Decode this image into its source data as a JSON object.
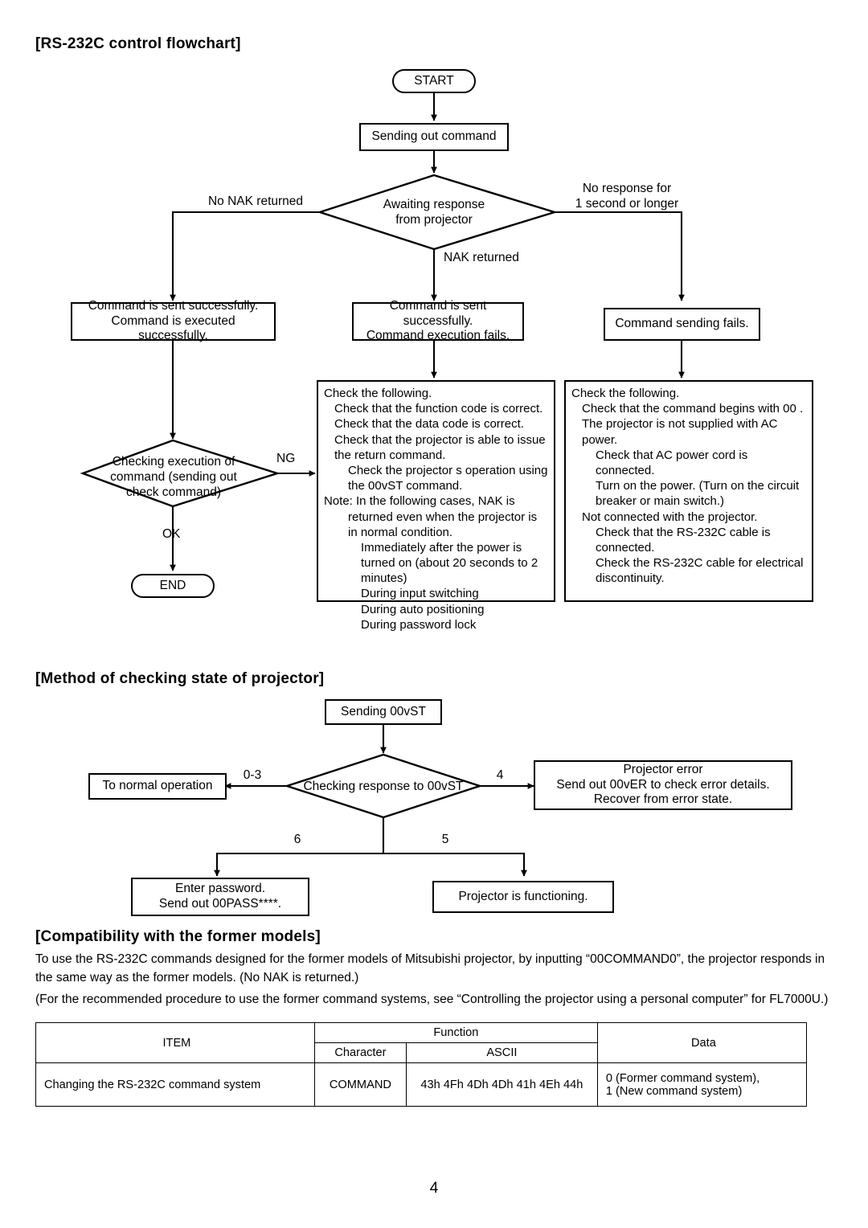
{
  "page": {
    "number": "4"
  },
  "sections": {
    "flowchart": {
      "heading": "[RS-232C control  flowchart]",
      "nodes": {
        "start": "START",
        "sending_out_command": "Sending out command",
        "awaiting_response": "Awaiting response\nfrom projector",
        "ok_box": "Command is sent successfully.\nCommand is executed successfully.",
        "nak_box": "Command is sent successfully.\nCommand execution fails.",
        "fail_box": "Command sending fails.",
        "checking_execution": "Checking execution of\ncommand (sending out\ncheck command)",
        "end": "END"
      },
      "edge_labels": {
        "no_nak": "No NAK returned",
        "nak": "NAK returned",
        "no_response": "No response for\n1 second or longer",
        "ng": "NG",
        "ok": "OK"
      },
      "detail_nak": {
        "title": "Check the following.",
        "lines": [
          {
            "indent": 1,
            "text": "Check that the function code is correct."
          },
          {
            "indent": 1,
            "text": "Check that the data code is correct."
          },
          {
            "indent": 1,
            "text": "Check that the projector is able to issue the return command."
          },
          {
            "indent": 2,
            "text": "Check the projector s operation using the 00vST command."
          },
          {
            "indent": 0,
            "text": "Note:  In the following cases, NAK is"
          },
          {
            "indent": 2,
            "text": "returned even when the projector is in normal condition."
          },
          {
            "indent": 3,
            "text": "Immediately after the power is turned on (about 20 seconds to 2 minutes)"
          },
          {
            "indent": 3,
            "text": "During input switching"
          },
          {
            "indent": 3,
            "text": "During auto positioning"
          },
          {
            "indent": 3,
            "text": "During password lock"
          }
        ]
      },
      "detail_fail": {
        "title": "Check the following.",
        "lines": [
          {
            "indent": 1,
            "text": "Check that the command begins with  00 ."
          },
          {
            "indent": 1,
            "text": "The projector is not supplied with AC power."
          },
          {
            "indent": 2,
            "text": "Check that AC power cord is connected."
          },
          {
            "indent": 2,
            "text": "Turn on the power. (Turn on the circuit breaker or main switch.)"
          },
          {
            "indent": 1,
            "text": "Not connected with the projector."
          },
          {
            "indent": 2,
            "text": "Check that the RS-232C cable is connected."
          },
          {
            "indent": 2,
            "text": "Check the RS-232C cable for electrical discontinuity."
          }
        ]
      }
    },
    "method": {
      "heading": "[Method of checking state of projector]",
      "nodes": {
        "sending": "Sending 00vST",
        "checking": "Checking response to 00vST",
        "normal": "To normal operation",
        "error": "Projector error\nSend out  00vER  to check error details.\nRecover from error state.",
        "password": "Enter password.\nSend out  00PASS****.",
        "functioning": "Projector is functioning."
      },
      "edge_labels": {
        "zero_to_three": "0-3",
        "four": "4",
        "six": "6",
        "five": "5"
      }
    },
    "compatibility": {
      "heading": "[Compatibility with the former models]",
      "paragraph_1": "To use the RS-232C commands designed for the former models of Mitsubishi projector, by inputting “00COMMAND0”, the projector responds in the same way as the former models. (No NAK is returned.)",
      "paragraph_2": "(For the recommended procedure to use the former command systems, see “Controlling the projector using a personal computer” for FL7000U.)",
      "table": {
        "headers": {
          "item": "ITEM",
          "function": "Function",
          "character": "Character",
          "ascii": "ASCII",
          "data": "Data"
        },
        "rows": [
          {
            "item": "Changing the RS-232C command system",
            "character": "COMMAND",
            "ascii": "43h 4Fh 4Dh 4Dh 41h 4Eh 44h",
            "data": "0 (Former command system),\n1 (New command system)"
          }
        ]
      }
    }
  }
}
